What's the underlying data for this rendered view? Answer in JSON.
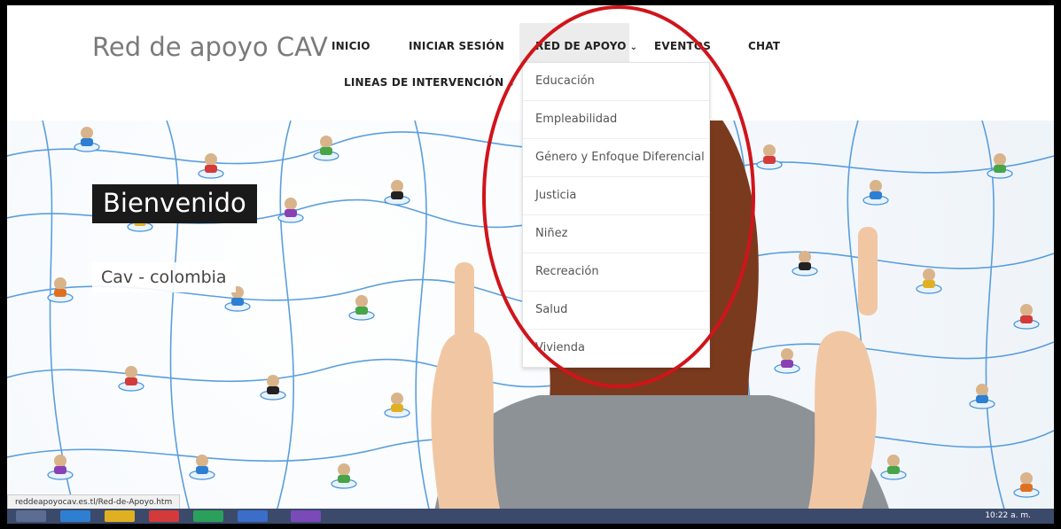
{
  "header": {
    "brand": "Red de apoyo CAV",
    "nav": [
      {
        "label": "INICIO"
      },
      {
        "label": "INICIAR SESIÓN"
      },
      {
        "label": "RED DE APOYO"
      },
      {
        "label": "EVENTOS"
      },
      {
        "label": "CHAT"
      },
      {
        "label": "LINEAS DE INTERVENCIÓN"
      }
    ],
    "chevron": "⌄"
  },
  "dropdown": {
    "items": [
      {
        "label": "Educación"
      },
      {
        "label": "Empleabilidad"
      },
      {
        "label": "Género y Enfoque Diferencial"
      },
      {
        "label": "Justicia"
      },
      {
        "label": "Niñez"
      },
      {
        "label": "Recreación"
      },
      {
        "label": "Salud"
      },
      {
        "label": "Vivienda"
      }
    ]
  },
  "hero": {
    "title": "Bienvenido",
    "subtitle": "Cav - colombia"
  },
  "statusbar": {
    "url": "reddeapoyocav.es.tl/Red-de-Apoyo.htm"
  },
  "taskbar": {
    "clock": "10:22 a. m."
  },
  "colors": {
    "annotation": "#d0141b",
    "network_line": "#3f8fd8",
    "dark_caption": "#1a1a1a"
  }
}
